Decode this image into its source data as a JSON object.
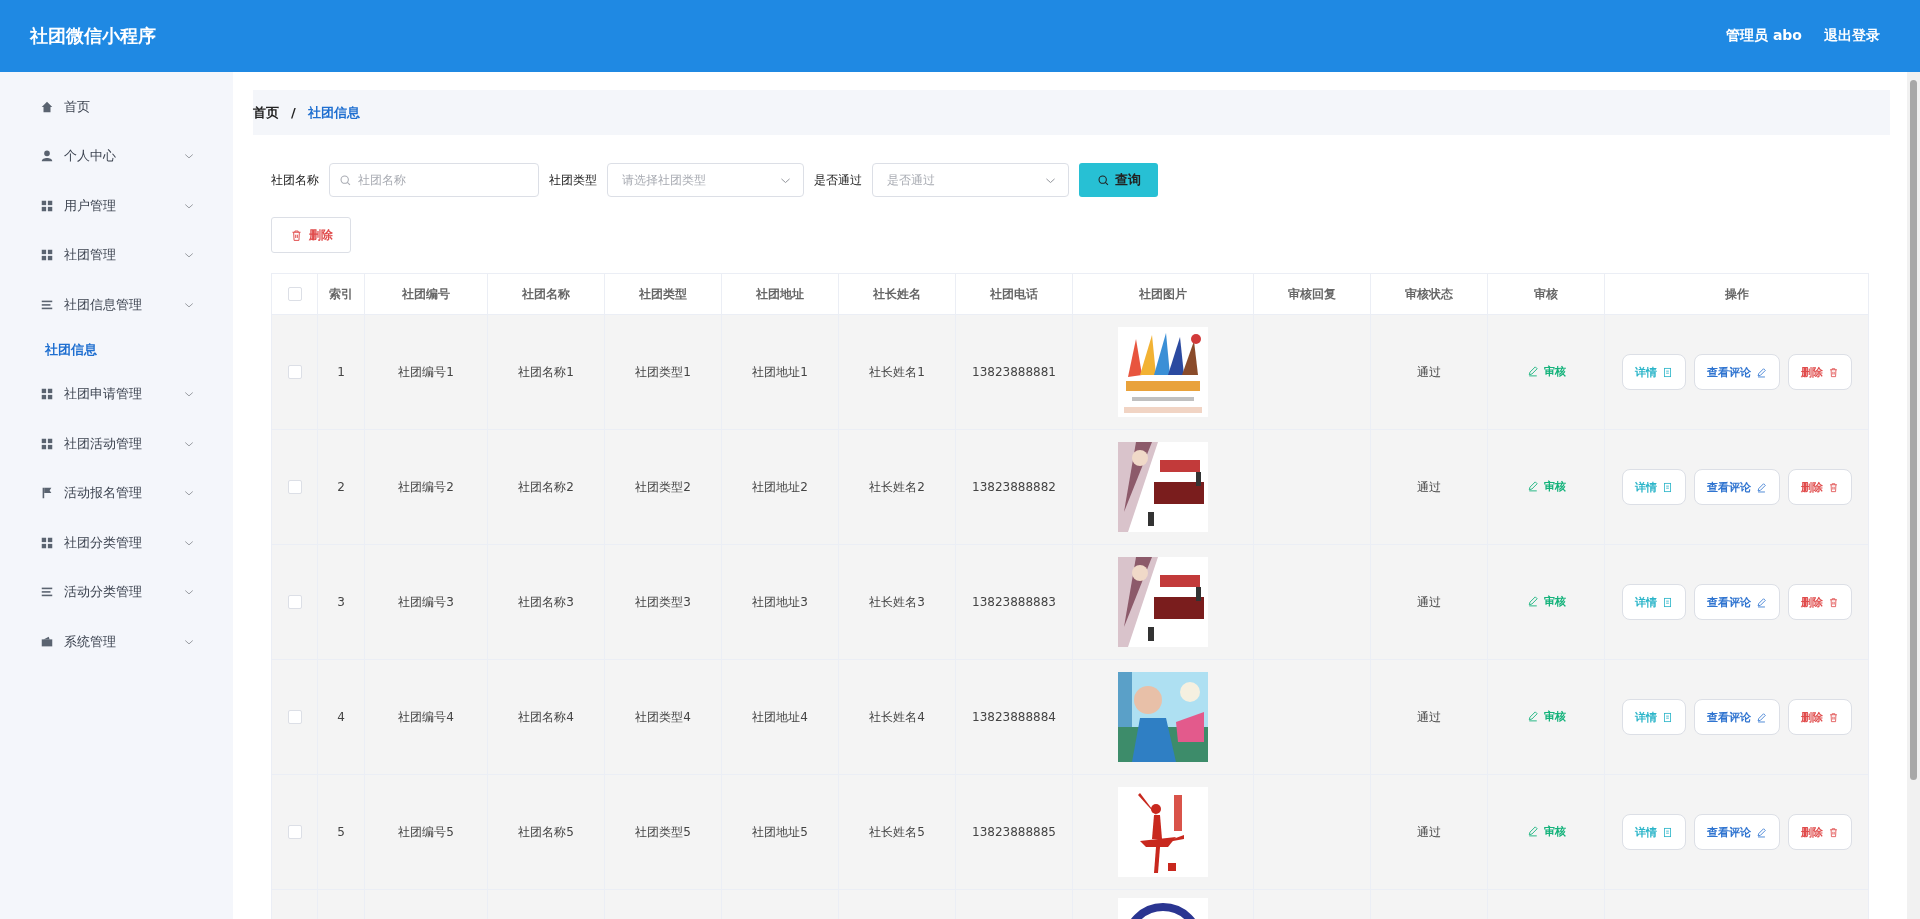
{
  "header": {
    "title": "社团微信小程序",
    "user": "管理员 abo",
    "logout": "退出登录"
  },
  "sidebar": {
    "items": [
      {
        "label": "首页",
        "kind": "link",
        "selected": false
      },
      {
        "label": "个人中心",
        "kind": "submenu",
        "selected": false
      },
      {
        "label": "用户管理",
        "kind": "submenu",
        "selected": false
      },
      {
        "label": "社团管理",
        "kind": "submenu",
        "selected": false
      },
      {
        "label": "社团信息管理",
        "kind": "submenu",
        "selected": false,
        "children": [
          {
            "label": "社团信息",
            "selected": true
          }
        ]
      },
      {
        "label": "社团申请管理",
        "kind": "submenu",
        "selected": false
      },
      {
        "label": "社团活动管理",
        "kind": "submenu",
        "selected": false
      },
      {
        "label": "活动报名管理",
        "kind": "submenu",
        "selected": false
      },
      {
        "label": "社团分类管理",
        "kind": "submenu",
        "selected": false
      },
      {
        "label": "活动分类管理",
        "kind": "submenu",
        "selected": false
      },
      {
        "label": "系统管理",
        "kind": "submenu",
        "selected": false
      }
    ]
  },
  "breadcrumb": [
    {
      "label": "首页",
      "current": false
    },
    {
      "label": "社团信息",
      "current": true
    }
  ],
  "separator": "/",
  "filters": [
    {
      "label": "社团名称",
      "kind": "text",
      "placeholder": "社团名称"
    },
    {
      "label": "社团类型",
      "kind": "select",
      "placeholder": "请选择社团类型"
    },
    {
      "label": "是否通过",
      "kind": "select",
      "placeholder": "是否通过"
    }
  ],
  "search_button": "查询",
  "delete_button": "删除",
  "table": {
    "header_checked": false,
    "columns": [
      "索引",
      "社团编号",
      "社团名称",
      "社团类型",
      "社团地址",
      "社长姓名",
      "社团电话",
      "社团图片",
      "审核回复",
      "审核状态",
      "审核",
      "操作"
    ],
    "rows": [
      {
        "kind": "full",
        "checked": false,
        "cells": [
          "1",
          "社团编号1",
          "社团名称1",
          "社团类型1",
          "社团地址1",
          "社长姓名1",
          "13823888881"
        ],
        "status": "通过",
        "review": "审核",
        "actions": [
          {
            "label": "详情",
            "kind": "detail"
          },
          {
            "label": "查看评论",
            "kind": "comment"
          },
          {
            "label": "删除",
            "kind": "delete"
          }
        ]
      },
      {
        "kind": "full",
        "checked": false,
        "cells": [
          "2",
          "社团编号2",
          "社团名称2",
          "社团类型2",
          "社团地址2",
          "社长姓名2",
          "13823888882"
        ],
        "status": "通过",
        "review": "审核",
        "actions": [
          {
            "label": "详情",
            "kind": "detail"
          },
          {
            "label": "查看评论",
            "kind": "comment"
          },
          {
            "label": "删除",
            "kind": "delete"
          }
        ]
      },
      {
        "kind": "full",
        "checked": false,
        "cells": [
          "3",
          "社团编号3",
          "社团名称3",
          "社团类型3",
          "社团地址3",
          "社长姓名3",
          "13823888883"
        ],
        "status": "通过",
        "review": "审核",
        "actions": [
          {
            "label": "详情",
            "kind": "detail"
          },
          {
            "label": "查看评论",
            "kind": "comment"
          },
          {
            "label": "删除",
            "kind": "delete"
          }
        ]
      },
      {
        "kind": "full",
        "checked": false,
        "cells": [
          "4",
          "社团编号4",
          "社团名称4",
          "社团类型4",
          "社团地址4",
          "社长姓名4",
          "13823888884"
        ],
        "status": "通过",
        "review": "审核",
        "actions": [
          {
            "label": "详情",
            "kind": "detail"
          },
          {
            "label": "查看评论",
            "kind": "comment"
          },
          {
            "label": "删除",
            "kind": "delete"
          }
        ]
      },
      {
        "kind": "full",
        "checked": false,
        "cells": [
          "5",
          "社团编号5",
          "社团名称5",
          "社团类型5",
          "社团地址5",
          "社长姓名5",
          "13823888885"
        ],
        "status": "通过",
        "review": "审核",
        "actions": [
          {
            "label": "详情",
            "kind": "detail"
          },
          {
            "label": "查看评论",
            "kind": "comment"
          },
          {
            "label": "删除",
            "kind": "delete"
          }
        ]
      },
      {
        "kind": "picture_only"
      }
    ]
  }
}
